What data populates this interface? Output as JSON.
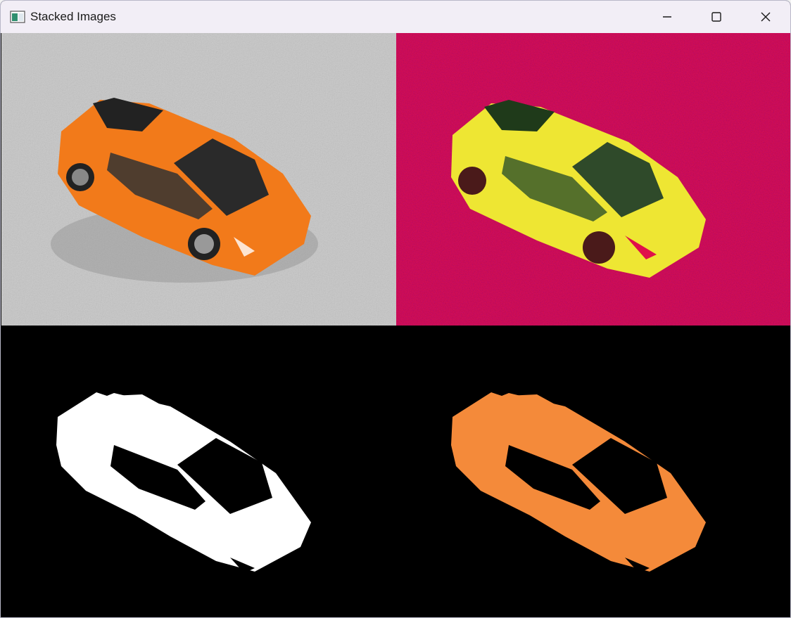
{
  "window": {
    "title": "Stacked Images",
    "icon": "app-window-icon",
    "controls": [
      "minimize-icon",
      "maximize-icon",
      "close-icon"
    ]
  },
  "panes": [
    {
      "name": "original-image",
      "background": "#c8c8c8",
      "car_color": "#f27a1a"
    },
    {
      "name": "hsv-image",
      "background": "#e0124e",
      "car_color": "#eee633"
    },
    {
      "name": "mask-image",
      "background": "#000000",
      "car_color": "#ffffff"
    },
    {
      "name": "result-image",
      "background": "#000000",
      "car_color": "#f48a3a"
    }
  ]
}
